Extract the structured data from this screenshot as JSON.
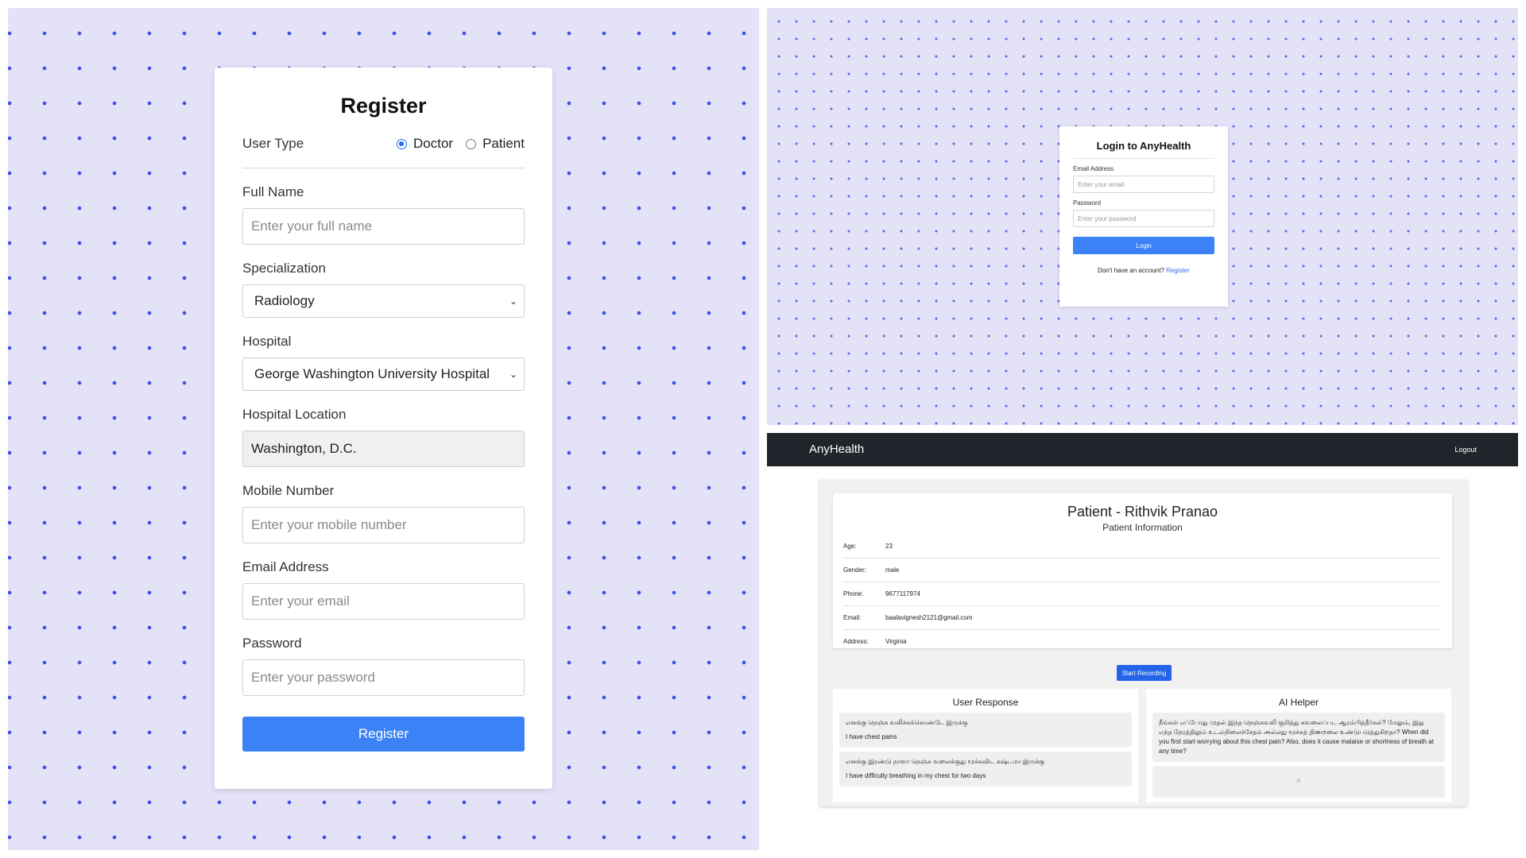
{
  "register": {
    "title": "Register",
    "user_type_label": "User Type",
    "user_type_options": [
      "Doctor",
      "Patient"
    ],
    "user_type_selected": "Doctor",
    "full_name": {
      "label": "Full Name",
      "placeholder": "Enter your full name"
    },
    "specialization": {
      "label": "Specialization",
      "value": "Radiology"
    },
    "hospital": {
      "label": "Hospital",
      "value": "George Washington University Hospital"
    },
    "hospital_location": {
      "label": "Hospital Location",
      "value": "Washington, D.C."
    },
    "mobile": {
      "label": "Mobile Number",
      "placeholder": "Enter your mobile number"
    },
    "email": {
      "label": "Email Address",
      "placeholder": "Enter your email"
    },
    "password": {
      "label": "Password",
      "placeholder": "Enter your password"
    },
    "submit_label": "Register"
  },
  "login": {
    "title": "Login to AnyHealth",
    "email_label": "Email Address",
    "email_placeholder": "Enter your email",
    "password_label": "Password",
    "password_placeholder": "Enter your password",
    "button_label": "Login",
    "footer_text": "Don't have an account?",
    "register_link": "Register"
  },
  "dashboard": {
    "brand": "AnyHealth",
    "logout_label": "Logout",
    "patient_title": "Patient - Rithvik Pranao",
    "patient_subtitle": "Patient Information",
    "info": [
      {
        "key": "Age:",
        "value": "23"
      },
      {
        "key": "Gender:",
        "value": "male"
      },
      {
        "key": "Phone:",
        "value": "9677117974"
      },
      {
        "key": "Email:",
        "value": "baalavignesh2121@gmail.com"
      },
      {
        "key": "Address:",
        "value": "Virginia"
      }
    ],
    "record_button": "Start Recording",
    "user_response": {
      "title": "User Response",
      "messages": [
        {
          "line1": "எனக்கு நெஞ்சு வலிச்சுக்கொண்டே இருக்கு",
          "line2": "I have chest pains"
        },
        {
          "line1": "எனக்கு இரண்டு நாளா நெஞ்சு வலைக்குது மூச்சுவிட கஷ்டமா இருக்கு",
          "line2": "I have difficulty breathing in my chest for two days"
        }
      ]
    },
    "ai_helper": {
      "title": "AI Helper",
      "message": "நீங்கள் எப்போது முதல் இந்த நெஞ்சுவலி குறித்து கவலைப்பட ஆரம்பித்தீர்கள்? மேலும், இது எந்த நேரத்திலும் உடல்நிலைச்சேதம் அல்லது மூச்சுத் திணறலை உண்டுபடுத்துகிறதா? When did you first start worrying about this chest pain? Also, does it cause malaise or shortness of breath at any time?",
      "loading_icon": "spinner-icon"
    }
  }
}
